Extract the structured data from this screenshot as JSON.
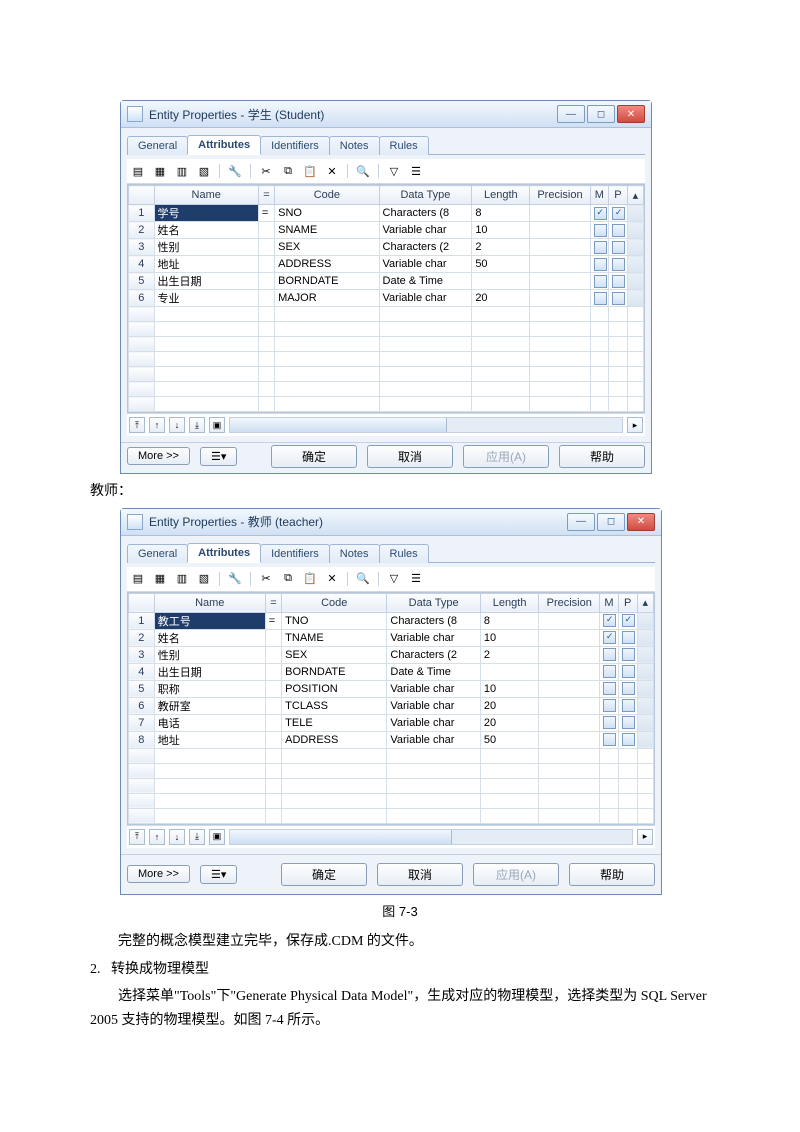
{
  "student": {
    "title": "Entity Properties - 学生 (Student)",
    "tabs": [
      "General",
      "Attributes",
      "Identifiers",
      "Notes",
      "Rules"
    ],
    "columns": [
      "",
      "Name",
      "",
      "Code",
      "Data Type",
      "Length",
      "Precision",
      "M",
      "P",
      ""
    ],
    "rows": [
      {
        "n": "1",
        "name": "学号",
        "code": "SNO",
        "dtype": "Characters (8",
        "len": "8",
        "m": true,
        "p": true
      },
      {
        "n": "2",
        "name": "姓名",
        "code": "SNAME",
        "dtype": "Variable char",
        "len": "10",
        "m": false,
        "p": false
      },
      {
        "n": "3",
        "name": "性别",
        "code": "SEX",
        "dtype": "Characters (2",
        "len": "2",
        "m": false,
        "p": false
      },
      {
        "n": "4",
        "name": "地址",
        "code": "ADDRESS",
        "dtype": "Variable char",
        "len": "50",
        "m": false,
        "p": false
      },
      {
        "n": "5",
        "name": "出生日期",
        "code": "BORNDATE",
        "dtype": "Date & Time",
        "len": "",
        "m": false,
        "p": false
      },
      {
        "n": "6",
        "name": "专业",
        "code": "MAJOR",
        "dtype": "Variable char",
        "len": "20",
        "m": false,
        "p": false
      }
    ],
    "buttons": {
      "more": "More >>",
      "ok": "确定",
      "cancel": "取消",
      "apply": "应用(A)",
      "help": "帮助"
    }
  },
  "teacher_label": "教师：",
  "teacher": {
    "title": "Entity Properties - 教师 (teacher)",
    "tabs": [
      "General",
      "Attributes",
      "Identifiers",
      "Notes",
      "Rules"
    ],
    "columns": [
      "",
      "Name",
      "",
      "Code",
      "Data Type",
      "Length",
      "Precision",
      "M",
      "P",
      ""
    ],
    "rows": [
      {
        "n": "1",
        "name": "教工号",
        "code": "TNO",
        "dtype": "Characters (8",
        "len": "8",
        "m": true,
        "p": true
      },
      {
        "n": "2",
        "name": "姓名",
        "code": "TNAME",
        "dtype": "Variable char",
        "len": "10",
        "m": true,
        "p": false
      },
      {
        "n": "3",
        "name": "性别",
        "code": "SEX",
        "dtype": "Characters (2",
        "len": "2",
        "m": false,
        "p": false
      },
      {
        "n": "4",
        "name": "出生日期",
        "code": "BORNDATE",
        "dtype": "Date & Time",
        "len": "",
        "m": false,
        "p": false
      },
      {
        "n": "5",
        "name": "职称",
        "code": "POSITION",
        "dtype": "Variable char",
        "len": "10",
        "m": false,
        "p": false
      },
      {
        "n": "6",
        "name": "教研室",
        "code": "TCLASS",
        "dtype": "Variable char",
        "len": "20",
        "m": false,
        "p": false
      },
      {
        "n": "7",
        "name": "电话",
        "code": "TELE",
        "dtype": "Variable char",
        "len": "20",
        "m": false,
        "p": false
      },
      {
        "n": "8",
        "name": "地址",
        "code": "ADDRESS",
        "dtype": "Variable char",
        "len": "50",
        "m": false,
        "p": false
      }
    ],
    "buttons": {
      "more": "More >>",
      "ok": "确定",
      "cancel": "取消",
      "apply": "应用(A)",
      "help": "帮助"
    }
  },
  "caption": "图 7-3",
  "para1": "完整的概念模型建立完毕，保存成.CDM 的文件。",
  "list2_num": "2.",
  "list2_title": "转换成物理模型",
  "para2": "选择菜单\"Tools\"下\"Generate Physical Data Model\"，生成对应的物理模型，选择类型为 SQL Server 2005 支持的物理模型。如图 7-4 所示。"
}
